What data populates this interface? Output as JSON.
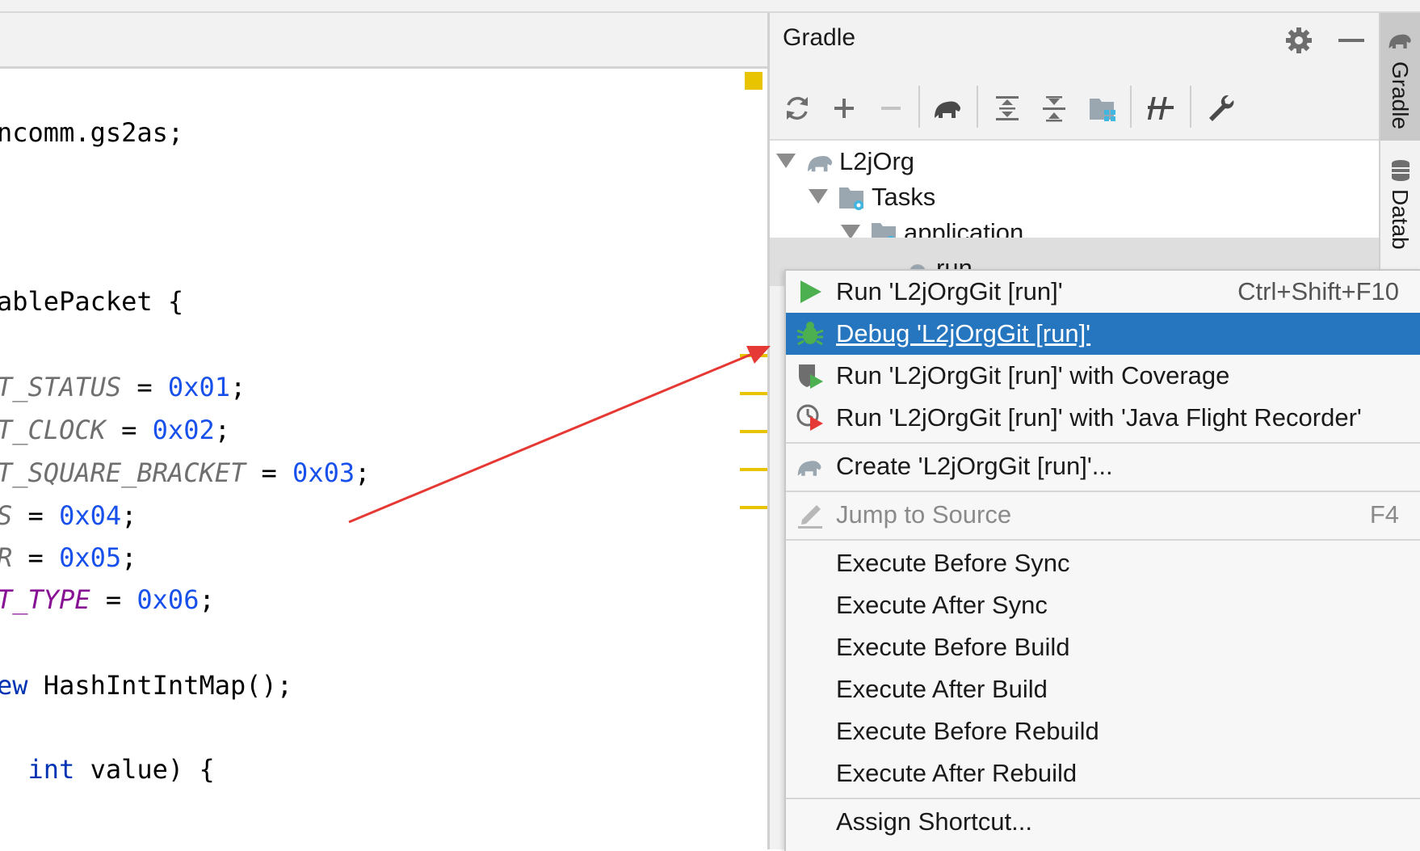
{
  "editor": {
    "lines": [
      {
        "segments": [
          {
            "t": "ncomm.gs2as;",
            "c": ""
          }
        ]
      },
      {
        "segments": [
          {
            "t": "ablePacket {",
            "c": ""
          }
        ]
      },
      {
        "segments": [
          {
            "t": "T_STATUS",
            "c": "c-gray"
          },
          {
            "t": " = ",
            "c": ""
          },
          {
            "t": "0x01",
            "c": "c-num"
          },
          {
            "t": ";",
            "c": ""
          }
        ]
      },
      {
        "segments": [
          {
            "t": "T_CLOCK",
            "c": "c-gray"
          },
          {
            "t": " = ",
            "c": ""
          },
          {
            "t": "0x02",
            "c": "c-num"
          },
          {
            "t": ";",
            "c": ""
          }
        ]
      },
      {
        "segments": [
          {
            "t": "T_SQUARE_BRACKET",
            "c": "c-gray"
          },
          {
            "t": " = ",
            "c": ""
          },
          {
            "t": "0x03",
            "c": "c-num"
          },
          {
            "t": ";",
            "c": ""
          }
        ]
      },
      {
        "segments": [
          {
            "t": "S",
            "c": "c-gray"
          },
          {
            "t": " = ",
            "c": ""
          },
          {
            "t": "0x04",
            "c": "c-num"
          },
          {
            "t": ";",
            "c": ""
          }
        ]
      },
      {
        "segments": [
          {
            "t": "R",
            "c": "c-gray"
          },
          {
            "t": " = ",
            "c": ""
          },
          {
            "t": "0x05",
            "c": "c-num"
          },
          {
            "t": ";",
            "c": ""
          }
        ]
      },
      {
        "segments": [
          {
            "t": "T_TYPE",
            "c": "c-purple"
          },
          {
            "t": " = ",
            "c": ""
          },
          {
            "t": "0x06",
            "c": "c-num"
          },
          {
            "t": ";",
            "c": ""
          }
        ]
      },
      {
        "segments": [
          {
            "t": "ew",
            "c": "c-kw"
          },
          {
            "t": " HashIntIntMap();",
            "c": ""
          }
        ]
      },
      {
        "segments": [
          {
            "t": "  ",
            "c": ""
          },
          {
            "t": "int",
            "c": "c-kw"
          },
          {
            "t": " value) {",
            "c": ""
          }
        ]
      }
    ]
  },
  "gradle": {
    "title": "Gradle",
    "tree": {
      "root": "L2jOrg",
      "tasks": "Tasks",
      "application": "application",
      "run": "run"
    }
  },
  "right_strip": {
    "gradle_tab": "Gradle",
    "database_tab": "Datab"
  },
  "menu": {
    "run": {
      "label": "Run 'L2jOrgGit [run]'",
      "shortcut": "Ctrl+Shift+F10"
    },
    "debug": {
      "label": "Debug 'L2jOrgGit [run]'"
    },
    "coverage": {
      "label": "Run 'L2jOrgGit [run]' with Coverage"
    },
    "jfr": {
      "label": "Run 'L2jOrgGit [run]' with 'Java Flight Recorder'"
    },
    "create": {
      "label": "Create 'L2jOrgGit [run]'..."
    },
    "jump": {
      "label": "Jump to Source",
      "shortcut": "F4"
    },
    "before_sync": {
      "label": "Execute Before Sync"
    },
    "after_sync": {
      "label": "Execute After Sync"
    },
    "before_build": {
      "label": "Execute Before Build"
    },
    "after_build": {
      "label": "Execute After Build"
    },
    "before_rebuild": {
      "label": "Execute Before Rebuild"
    },
    "after_rebuild": {
      "label": "Execute After Rebuild"
    },
    "assign_shortcut": {
      "label": "Assign Shortcut..."
    }
  },
  "colors": {
    "selection": "#2675bf",
    "run_green": "#4caf50",
    "annotation_arrow": "#e53935",
    "warning_mark": "#e8c400"
  }
}
